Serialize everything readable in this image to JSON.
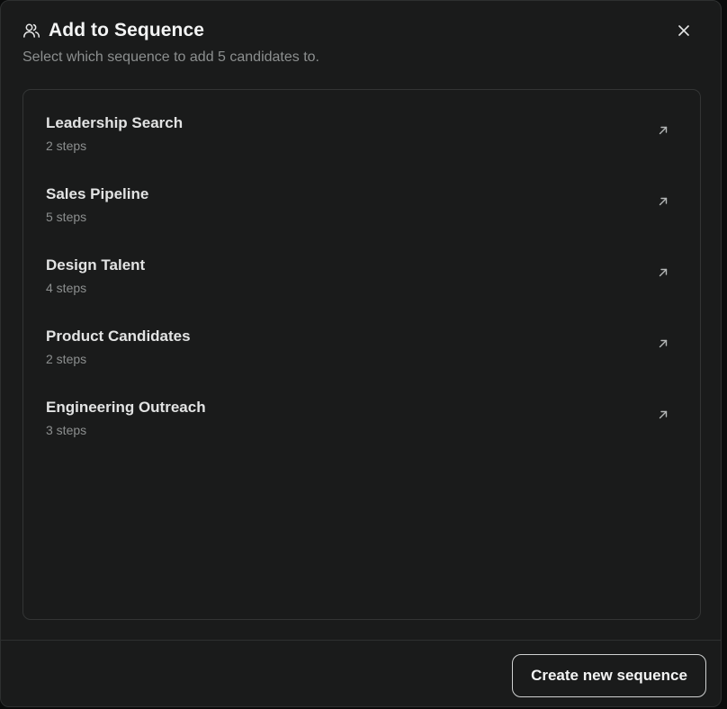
{
  "dialog": {
    "title": "Add to Sequence",
    "subtitle": "Select which sequence to add 5 candidates to.",
    "title_icon": "users-icon",
    "close_icon": "close-icon"
  },
  "sequences": [
    {
      "name": "Leadership Search",
      "steps": "2 steps",
      "icon": "open-external-arrow-icon"
    },
    {
      "name": "Sales Pipeline",
      "steps": "5 steps",
      "icon": "open-external-arrow-icon"
    },
    {
      "name": "Design Talent",
      "steps": "4 steps",
      "icon": "open-external-arrow-icon"
    },
    {
      "name": "Product Candidates",
      "steps": "2 steps",
      "icon": "open-external-arrow-icon"
    },
    {
      "name": "Engineering Outreach",
      "steps": "3 steps",
      "icon": "open-external-arrow-icon"
    }
  ],
  "footer": {
    "create_label": "Create new sequence"
  },
  "colors": {
    "background": "#1a1b1b",
    "border": "#333535",
    "text_primary": "#e2e3e3",
    "text_secondary": "#8c8f8f"
  }
}
